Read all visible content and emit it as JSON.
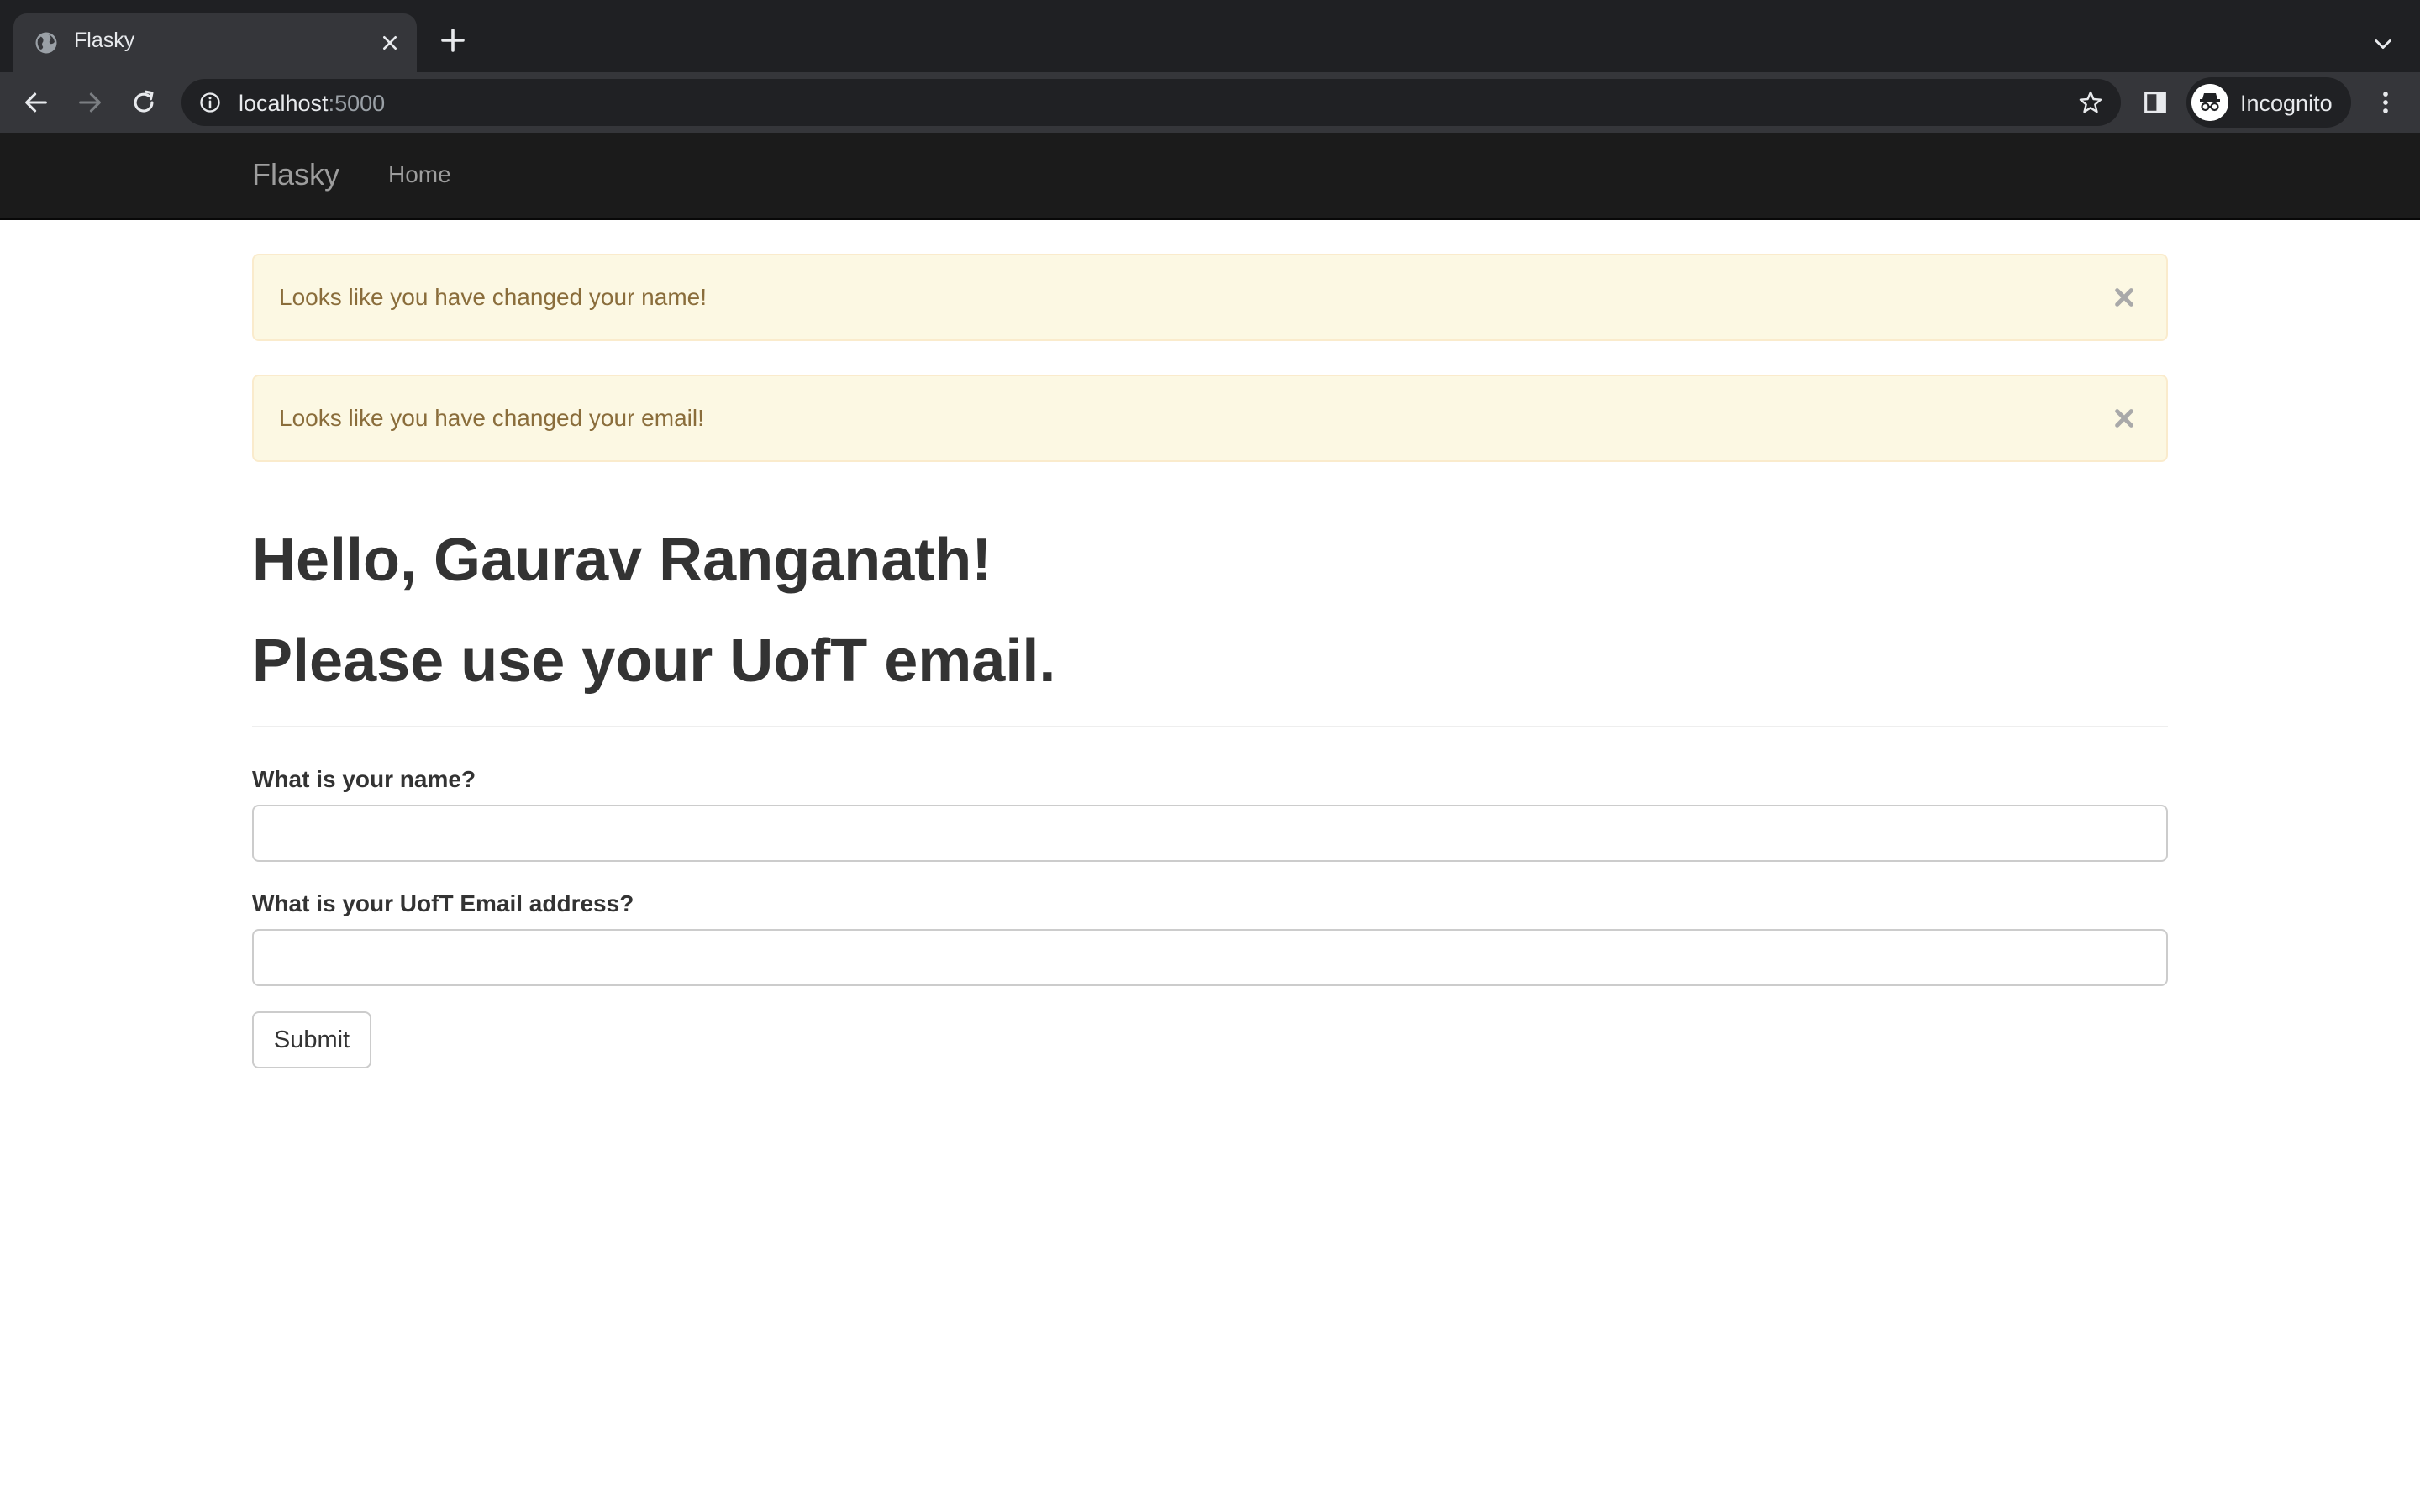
{
  "browser": {
    "tab_title": "Flasky",
    "url_host": "localhost",
    "url_port": ":5000",
    "profile_label": "Incognito",
    "icons": [
      "globe-icon",
      "close-icon",
      "plus-icon",
      "chevron-down-icon",
      "back-arrow-icon",
      "forward-arrow-icon",
      "reload-icon",
      "info-icon",
      "star-icon",
      "side-panel-icon",
      "incognito-icon",
      "kebab-menu-icon"
    ]
  },
  "navbar": {
    "brand": "Flasky",
    "items": [
      {
        "label": "Home"
      }
    ]
  },
  "alerts": [
    {
      "message": "Looks like you have changed your name!",
      "close_symbol": "×"
    },
    {
      "message": "Looks like you have changed your email!",
      "close_symbol": "×"
    }
  ],
  "page": {
    "greeting": "Hello, Gaurav Ranganath!",
    "notice": "Please use your UofT email."
  },
  "form": {
    "name_label": "What is your name?",
    "name_value": "",
    "email_label": "What is your UofT Email address?",
    "email_value": "",
    "submit_label": "Submit"
  },
  "colors": {
    "chrome_dark": "#1f2023",
    "chrome_toolbar": "#35363a",
    "navbar_bg": "#1b1b1b",
    "alert_bg": "#fcf8e3",
    "alert_border": "#faebcc",
    "alert_text": "#8a6d3b"
  }
}
